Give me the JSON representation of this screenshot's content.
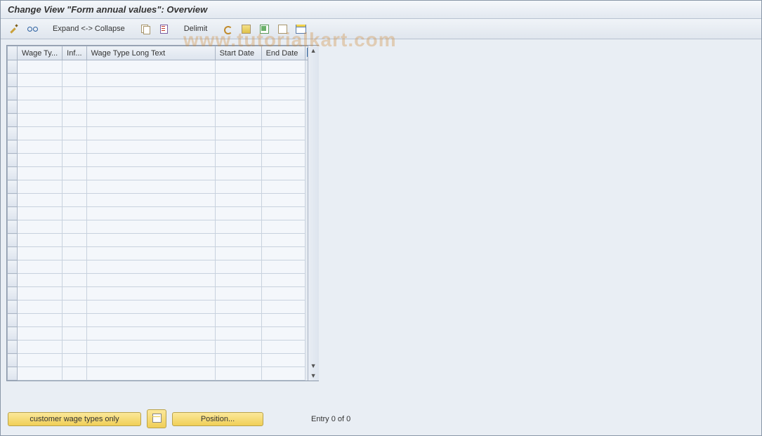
{
  "title": "Change View \"Form annual values\": Overview",
  "toolbar": {
    "expand_collapse": "Expand <-> Collapse",
    "delimit": "Delimit"
  },
  "columns": {
    "wage_type": "Wage Ty...",
    "info": "Inf...",
    "wage_type_long": "Wage Type Long Text",
    "start_date": "Start Date",
    "end_date": "End Date"
  },
  "footer": {
    "customer_btn": "customer wage types only",
    "position_btn": "Position...",
    "entry_text": "Entry 0 of 0"
  },
  "watermark": "www.tutorialkart.com",
  "row_count": 24
}
